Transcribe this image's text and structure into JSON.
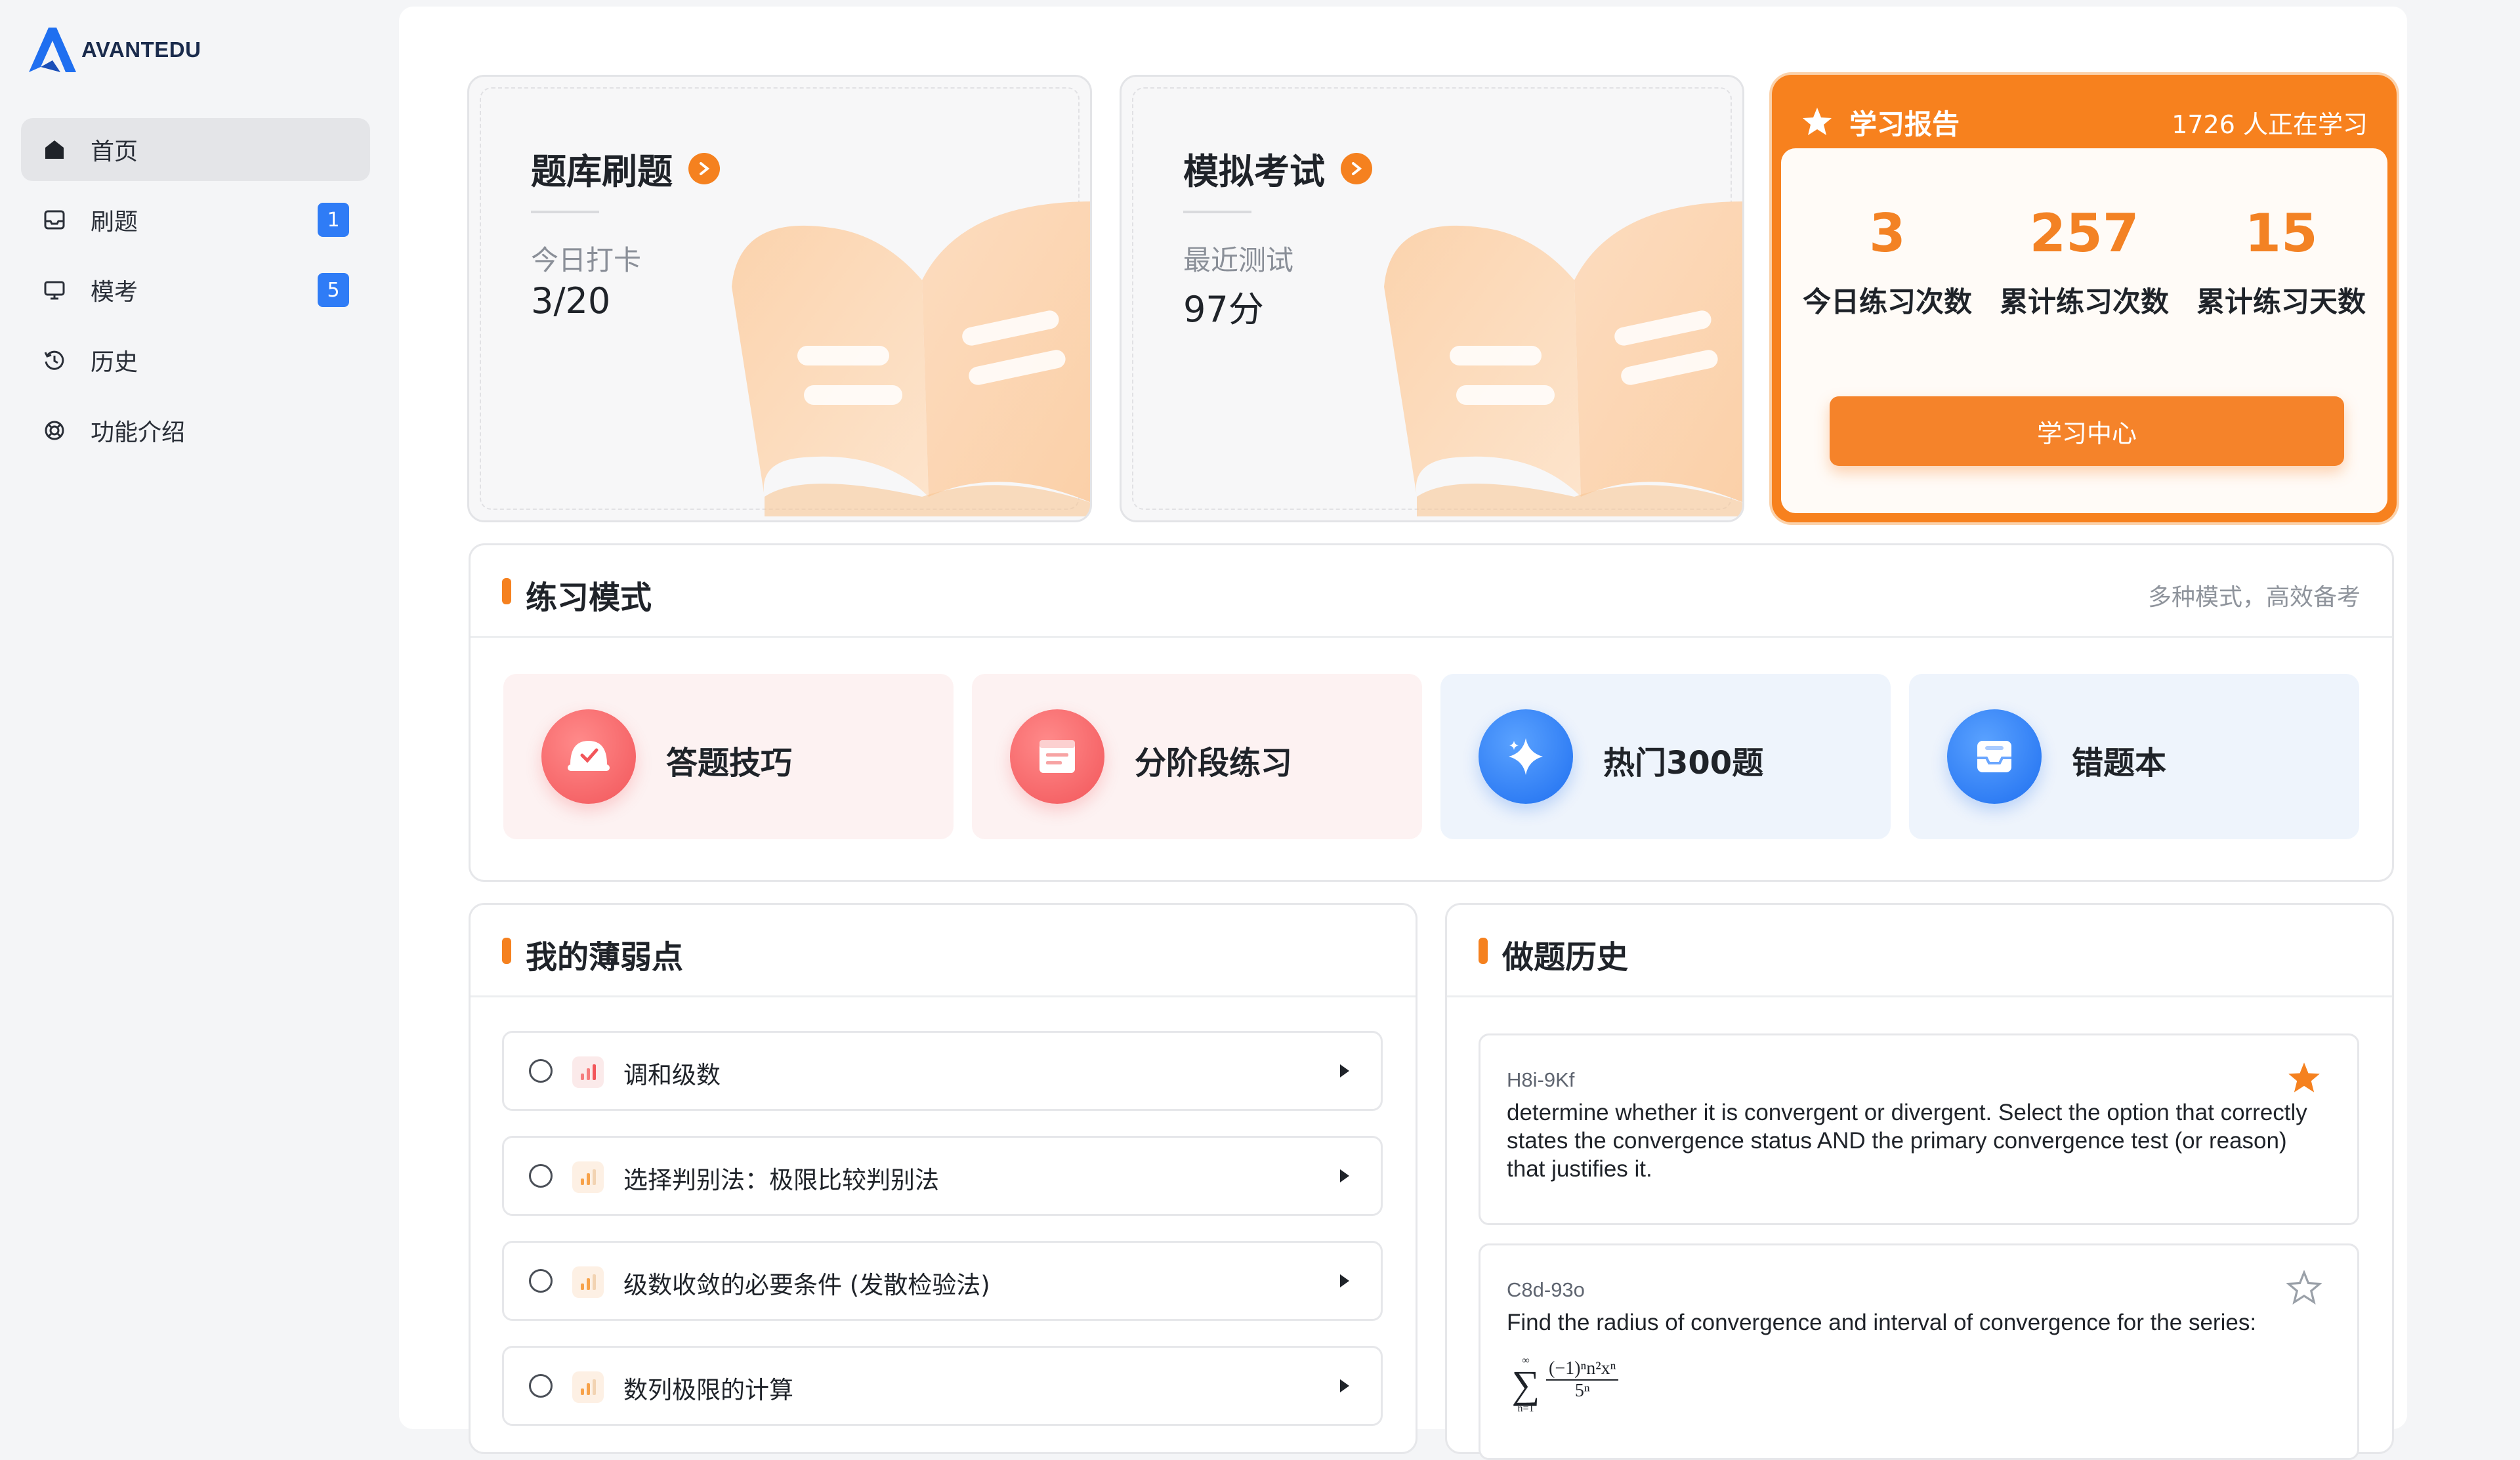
{
  "brand": {
    "name": "AVANTEDU",
    "accent": "#1f6ff0"
  },
  "sidebar": {
    "items": [
      {
        "label": "首页",
        "icon": "home-icon",
        "active": true,
        "badge": ""
      },
      {
        "label": "刷题",
        "icon": "inbox-icon",
        "active": false,
        "badge": "1"
      },
      {
        "label": "模考",
        "icon": "monitor-icon",
        "active": false,
        "badge": "5"
      },
      {
        "label": "历史",
        "icon": "history-icon",
        "active": false,
        "badge": ""
      },
      {
        "label": "功能介绍",
        "icon": "lifebuoy-icon",
        "active": false,
        "badge": ""
      }
    ]
  },
  "cards": {
    "question_bank": {
      "title": "题库刷题",
      "sub": "今日打卡",
      "value": "3/20"
    },
    "mock_exam": {
      "title": "模拟考试",
      "sub": "最近测试",
      "value": "97分"
    }
  },
  "report": {
    "title": "学习报告",
    "learners": "1726 人正在学习",
    "stats": [
      {
        "value": "3",
        "label": "今日练习次数"
      },
      {
        "value": "257",
        "label": "累计练习次数"
      },
      {
        "value": "15",
        "label": "累计练习天数"
      }
    ],
    "button": "学习中心",
    "accent": "#f7811e"
  },
  "practice": {
    "title": "练习模式",
    "note": "多种模式，高效备考",
    "modes": [
      {
        "label": "答题技巧",
        "icon": "helmet-icon",
        "tone": "red"
      },
      {
        "label": "分阶段练习",
        "icon": "calendar-icon",
        "tone": "red"
      },
      {
        "label": "热门300题",
        "icon": "sparkle-icon",
        "tone": "blue"
      },
      {
        "label": "错题本",
        "icon": "mailbox-icon",
        "tone": "blue"
      }
    ]
  },
  "weak": {
    "title": "我的薄弱点",
    "items": [
      {
        "label": "调和级数",
        "level": "high"
      },
      {
        "label": "选择判别法：极限比较判别法",
        "level": "mid"
      },
      {
        "label": "级数收敛的必要条件 (发散检验法)",
        "level": "mid"
      },
      {
        "label": "数列极限的计算",
        "level": "mid"
      }
    ]
  },
  "history": {
    "title": "做题历史",
    "items": [
      {
        "id": "H8i-9Kf",
        "starred": true,
        "text": "determine whether it is convergent or divergent. Select the option that correctly states the convergence status AND the primary convergence test (or reason) that justifies it."
      },
      {
        "id": "C8d-93o",
        "starred": false,
        "text": "Find the radius of convergence and interval of convergence for the series:",
        "formula": {
          "upper": "∞",
          "lower": "n=1",
          "numerator": "(−1)ⁿn²xⁿ",
          "denominator": "5ⁿ"
        }
      }
    ]
  }
}
